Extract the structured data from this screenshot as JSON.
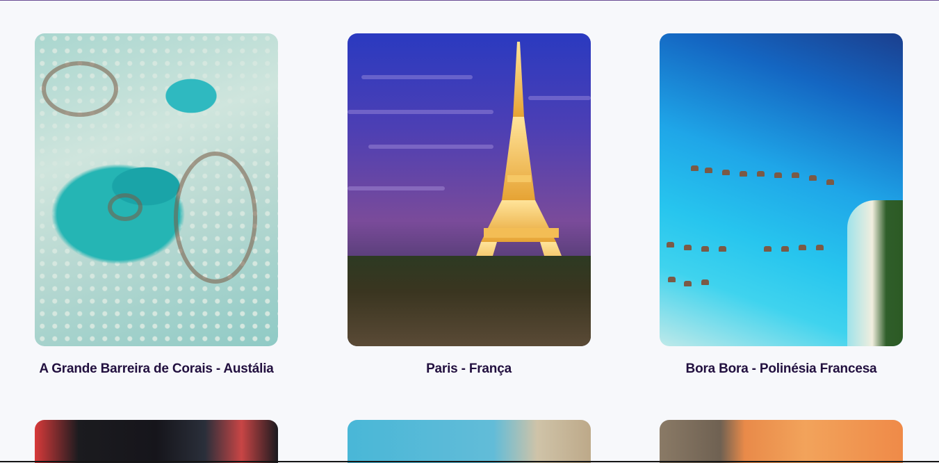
{
  "destinations": [
    {
      "caption": "A Grande Barreira de Corais - Austália",
      "image": "great-barrier-reef-photo"
    },
    {
      "caption": "Paris - França",
      "image": "eiffel-tower-photo"
    },
    {
      "caption": "Bora Bora - Polinésia Francesa",
      "image": "bora-bora-overwater-bungalows-photo"
    },
    {
      "caption": "",
      "image": "tokyo-street-neon-photo"
    },
    {
      "caption": "",
      "image": "rome-colosseum-photo"
    },
    {
      "caption": "",
      "image": "sunset-city-photo"
    }
  ],
  "colors": {
    "background": "#f7f8fb",
    "caption_text": "#22103f"
  }
}
